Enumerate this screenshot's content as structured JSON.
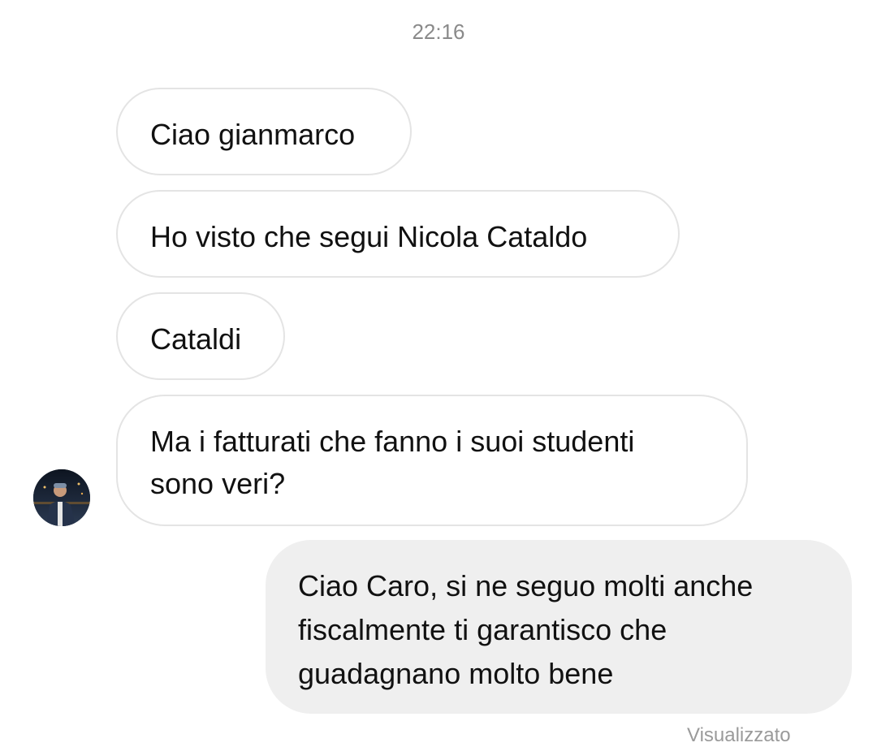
{
  "chat": {
    "timestamp": "22:16",
    "received": [
      {
        "text": "Ciao gianmarco"
      },
      {
        "text": "Ho visto che segui Nicola Cataldo"
      },
      {
        "text": "Cataldi"
      },
      {
        "lines": [
          "Ma i fatturati che fanno i suoi studenti",
          "sono veri?"
        ]
      }
    ],
    "sent": {
      "lines": [
        "Ciao Caro, si ne seguo molti anche",
        "fiscalmente ti garantisco che",
        "guadagnano molto bene"
      ]
    },
    "seen_label": "Visualizzato",
    "avatar_icon": "sender-avatar-icon"
  },
  "colors": {
    "incoming_bubble_bg": "#ffffff",
    "incoming_bubble_border": "#e4e4e4",
    "outgoing_bubble_bg": "#efefef",
    "timestamp_text": "#8a8a8a"
  }
}
